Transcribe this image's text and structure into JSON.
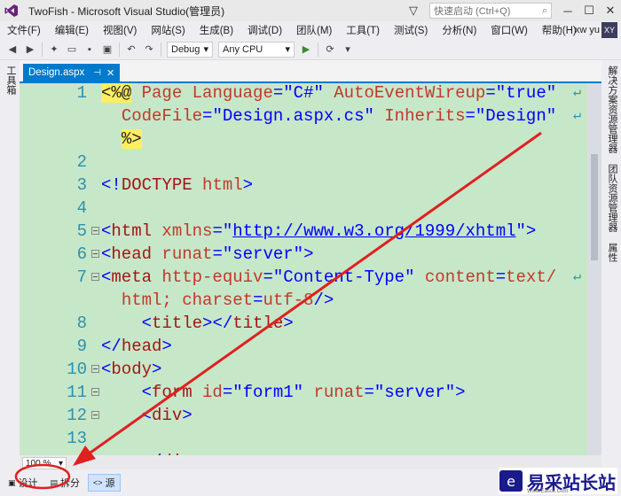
{
  "window": {
    "title": "TwoFish - Microsoft Visual Studio(管理员)",
    "quick_launch_placeholder": "快速启动 (Ctrl+Q)"
  },
  "menu": [
    "文件(F)",
    "编辑(E)",
    "视图(V)",
    "网站(S)",
    "生成(B)",
    "调试(D)",
    "团队(M)",
    "工具(T)",
    "测试(S)",
    "分析(N)",
    "窗口(W)",
    "帮助(H)"
  ],
  "user": {
    "name": "xw yu",
    "initials": "XY"
  },
  "toolbar": {
    "config": "Debug",
    "platform": "Any CPU"
  },
  "left_tabs": [
    "工具箱"
  ],
  "right_tabs": [
    "解决方案资源管理器",
    "团队资源管理器",
    "属性"
  ],
  "document_tab": {
    "name": "Design.aspx"
  },
  "code_lines": [
    {
      "num": "1",
      "text": "<%@ Page Language=\"C#\" AutoEventWireup=\"true\"",
      "wrap": true
    },
    {
      "num": "",
      "text": "  CodeFile=\"Design.aspx.cs\" Inherits=\"Design\"",
      "wrap": true
    },
    {
      "num": "",
      "text": "  %>",
      "wrap": false
    },
    {
      "num": "2",
      "text": "",
      "wrap": false
    },
    {
      "num": "3",
      "text": "<!DOCTYPE html>",
      "wrap": false
    },
    {
      "num": "4",
      "text": "",
      "wrap": false
    },
    {
      "num": "5",
      "text": "<html xmlns=\"http://www.w3.org/1999/xhtml\">",
      "wrap": false
    },
    {
      "num": "6",
      "text": "<head runat=\"server\">",
      "wrap": false
    },
    {
      "num": "7",
      "text": "<meta http-equiv=\"Content-Type\" content=\"text/",
      "wrap": true
    },
    {
      "num": "",
      "text": "  html; charset=utf-8\"/>",
      "wrap": false
    },
    {
      "num": "8",
      "text": "    <title></title>",
      "wrap": false
    },
    {
      "num": "9",
      "text": "</head>",
      "wrap": false
    },
    {
      "num": "10",
      "text": "<body>",
      "wrap": false
    },
    {
      "num": "11",
      "text": "    <form id=\"form1\" runat=\"server\">",
      "wrap": false
    },
    {
      "num": "12",
      "text": "    <div>",
      "wrap": false
    },
    {
      "num": "13",
      "text": "",
      "wrap": false
    },
    {
      "num": "",
      "text": "    </div>",
      "wrap": false
    }
  ],
  "zoom": "100 %",
  "view_buttons": [
    {
      "label": "设计",
      "active": false
    },
    {
      "label": "拆分",
      "active": false
    },
    {
      "label": "源",
      "active": true
    }
  ],
  "watermark": {
    "text": "易采站长站",
    "sub": "Www.Easck.Com"
  }
}
